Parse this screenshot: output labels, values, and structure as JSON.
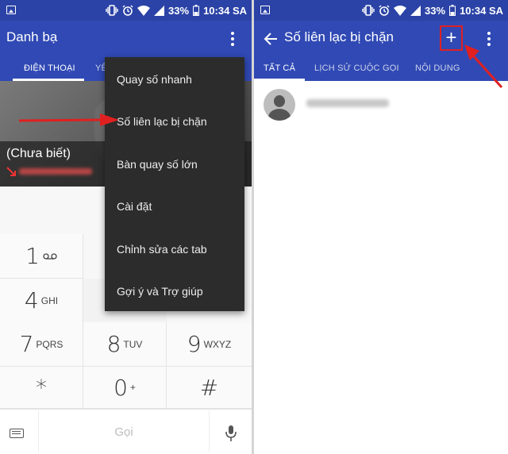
{
  "status": {
    "battery": "33%",
    "time": "10:34 SA"
  },
  "left": {
    "title": "Danh bạ",
    "tabs": [
      "ĐIỆN THOẠI",
      "YÊ"
    ],
    "caller": {
      "name": "(Chưa biết)"
    },
    "menu": {
      "items": [
        "Quay số nhanh",
        "Số liên lạc bị chặn",
        "Bàn quay số lớn",
        "Cài đặt",
        "Chỉnh sửa các tab",
        "Gợi ý và Trợ giúp"
      ]
    },
    "keypad": {
      "keys": [
        {
          "digit": "1",
          "letters": ""
        },
        {
          "digit": "4",
          "letters": "GHI"
        },
        {
          "digit": "7",
          "letters": "PQRS"
        },
        {
          "digit": "8",
          "letters": "TUV"
        },
        {
          "digit": "9",
          "letters": "WXYZ"
        },
        {
          "digit": "*",
          "letters": ""
        },
        {
          "digit": "0",
          "letters": "+"
        },
        {
          "digit": "#",
          "letters": ""
        }
      ]
    },
    "call_label": "Gọi"
  },
  "right": {
    "title": "Số liên lạc bị chặn",
    "add_label": "+",
    "tabs": [
      "TẤT CẢ",
      "LỊCH SỬ CUỘC GỌI",
      "NỘI DUNG"
    ]
  },
  "colors": {
    "appbar": "#3049b4",
    "statusbar": "#2b43a6",
    "annotation": "#e02020"
  }
}
